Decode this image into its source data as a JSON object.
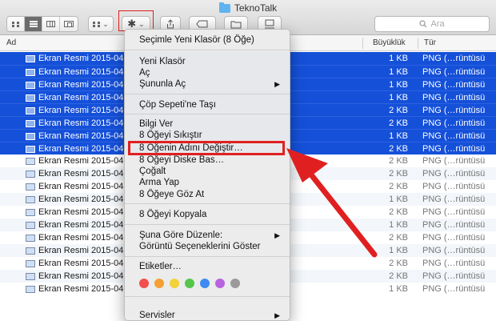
{
  "window": {
    "title": "TeknoTalk"
  },
  "toolbar": {
    "view_buttons": [
      "icon-view-icon",
      "list-view-icon",
      "column-view-icon",
      "coverflow-view-icon"
    ],
    "arrange_icon": "arrange-grid-icon",
    "action_icon": "gear-icon",
    "share_icon": "share-icon",
    "tag_icon": "tag-icon",
    "newfolder_icon": "folder-icon",
    "airdrop_icon": "drive-icon",
    "search_placeholder": "Ara"
  },
  "columns": {
    "name": "Ad",
    "size": "Büyüklük",
    "kind": "Tür"
  },
  "files": [
    {
      "name": "Ekran Resmi 2015-04-",
      "size": "1 KB",
      "kind": "PNG (…rüntüsü",
      "selected": true
    },
    {
      "name": "Ekran Resmi 2015-04-",
      "size": "1 KB",
      "kind": "PNG (…rüntüsü",
      "selected": true
    },
    {
      "name": "Ekran Resmi 2015-04-",
      "size": "1 KB",
      "kind": "PNG (…rüntüsü",
      "selected": true
    },
    {
      "name": "Ekran Resmi 2015-04-",
      "size": "1 KB",
      "kind": "PNG (…rüntüsü",
      "selected": true
    },
    {
      "name": "Ekran Resmi 2015-04-",
      "size": "2 KB",
      "kind": "PNG (…rüntüsü",
      "selected": true
    },
    {
      "name": "Ekran Resmi 2015-04-",
      "size": "2 KB",
      "kind": "PNG (…rüntüsü",
      "selected": true
    },
    {
      "name": "Ekran Resmi 2015-04-",
      "size": "1 KB",
      "kind": "PNG (…rüntüsü",
      "selected": true
    },
    {
      "name": "Ekran Resmi 2015-04-",
      "size": "2 KB",
      "kind": "PNG (…rüntüsü",
      "selected": true
    },
    {
      "name": "Ekran Resmi 2015-04-",
      "size": "2 KB",
      "kind": "PNG (…rüntüsü",
      "selected": false
    },
    {
      "name": "Ekran Resmi 2015-04-",
      "size": "2 KB",
      "kind": "PNG (…rüntüsü",
      "selected": false
    },
    {
      "name": "Ekran Resmi 2015-04-",
      "size": "2 KB",
      "kind": "PNG (…rüntüsü",
      "selected": false
    },
    {
      "name": "Ekran Resmi 2015-04-",
      "size": "1 KB",
      "kind": "PNG (…rüntüsü",
      "selected": false
    },
    {
      "name": "Ekran Resmi 2015-04-",
      "size": "2 KB",
      "kind": "PNG (…rüntüsü",
      "selected": false
    },
    {
      "name": "Ekran Resmi 2015-04-",
      "size": "1 KB",
      "kind": "PNG (…rüntüsü",
      "selected": false
    },
    {
      "name": "Ekran Resmi 2015-04-",
      "size": "2 KB",
      "kind": "PNG (…rüntüsü",
      "selected": false
    },
    {
      "name": "Ekran Resmi 2015-04-",
      "size": "1 KB",
      "kind": "PNG (…rüntüsü",
      "selected": false
    },
    {
      "name": "Ekran Resmi 2015-04-",
      "size": "2 KB",
      "kind": "PNG (…rüntüsü",
      "selected": false
    },
    {
      "name": "Ekran Resmi 2015-04-",
      "size": "2 KB",
      "kind": "PNG (…rüntüsü",
      "selected": false
    },
    {
      "name": "Ekran Resmi 2015-04-",
      "size": "1 KB",
      "kind": "PNG (…rüntüsü",
      "selected": false
    }
  ],
  "menu": {
    "new_folder_with_selection": "Seçimle Yeni Klasör (8 Öğe)",
    "new_folder": "Yeni Klasör",
    "open": "Aç",
    "open_with": "Şununla Aç",
    "move_to_trash": "Çöp Sepeti'ne Taşı",
    "get_info": "Bilgi Ver",
    "compress": "8 Öğeyi Sıkıştır",
    "rename": "8 Öğenin Adını Değiştir…",
    "burn": "8 Öğeyi Diske Bas…",
    "duplicate": "Çoğalt",
    "make_alias": "Arma Yap",
    "quick_look": "8 Öğeye Göz At",
    "copy": "8 Öğeyi Kopyala",
    "arrange_by": "Şuna Göre Düzenle:",
    "show_view_options": "Görüntü Seçeneklerini Göster",
    "tags": "Etiketler…",
    "services": "Servisler",
    "submenu_arrow": "▶"
  },
  "tag_colors": [
    "#f24e4e",
    "#f5a033",
    "#f2d23a",
    "#55c64b",
    "#3d8bf0",
    "#b864e0",
    "#9a9a9a"
  ],
  "annotations": {
    "highlight_color": "#e02020"
  }
}
